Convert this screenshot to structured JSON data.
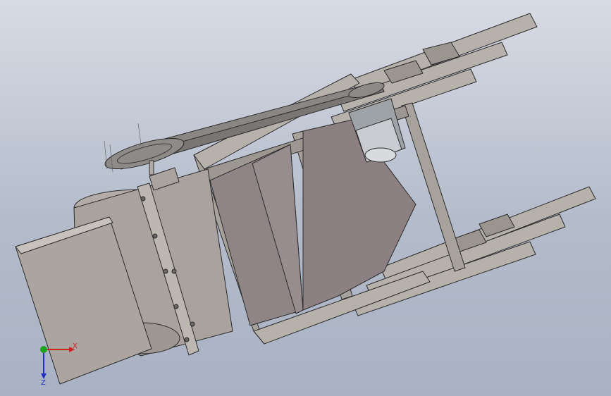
{
  "viewport": {
    "background_top": "#d7dbe4",
    "background_bottom": "#a9b2c3"
  },
  "model": {
    "components": [
      "blower-housing",
      "inlet-duct",
      "flange-plate",
      "hopper-chute",
      "support-frame",
      "motor",
      "drive-belt",
      "large-pulley",
      "small-pulley"
    ],
    "colors": {
      "housing": "#a9a29e",
      "frame": "#b7b1ac",
      "frame_shadow": "#8c8682",
      "hopper": "#8f8486",
      "motor": "#9ea3a8",
      "outline": "#2b2b2b"
    }
  },
  "triad": {
    "x_label": "X",
    "z_label": "Z",
    "x_color": "#d02020",
    "y_color": "#20a020",
    "z_color": "#2030c0"
  }
}
